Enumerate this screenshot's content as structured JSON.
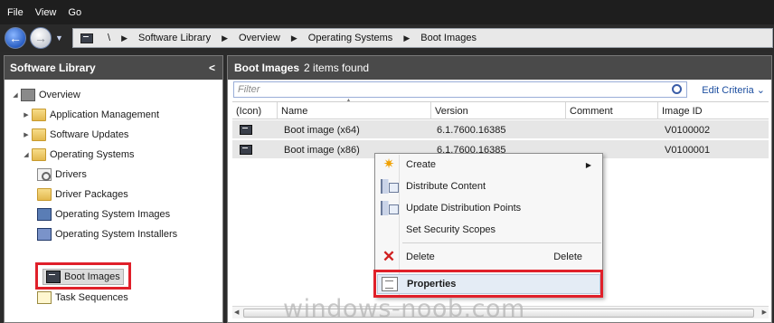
{
  "menubar": {
    "items": [
      "File",
      "View",
      "Go"
    ]
  },
  "address": {
    "crumbs": [
      "Software Library",
      "Overview",
      "Operating Systems",
      "Boot Images"
    ],
    "root_sep": "\\"
  },
  "left_panel": {
    "title": "Software Library",
    "collapse_glyph": "<",
    "tree": [
      {
        "label": "Overview",
        "icon": "overview-icon",
        "level": 0,
        "expanded": true
      },
      {
        "label": "Application Management",
        "icon": "folder-icon",
        "level": 1,
        "expanded": false
      },
      {
        "label": "Software Updates",
        "icon": "folder-icon",
        "level": 1,
        "expanded": false
      },
      {
        "label": "Operating Systems",
        "icon": "folder-icon",
        "level": 1,
        "expanded": true
      },
      {
        "label": "Drivers",
        "icon": "drivers-icon",
        "level": 2
      },
      {
        "label": "Driver Packages",
        "icon": "driver-packages-icon",
        "level": 2
      },
      {
        "label": "Operating System Images",
        "icon": "os-images-icon",
        "level": 2
      },
      {
        "label": "Operating System Installers",
        "icon": "os-installers-icon",
        "level": 2
      },
      {
        "label": "Boot Images",
        "icon": "boot-image-icon",
        "level": 2,
        "selected": true
      },
      {
        "label": "Task Sequences",
        "icon": "task-sequence-icon",
        "level": 1
      }
    ]
  },
  "right_panel": {
    "title": "Boot Images",
    "count": "2 items found",
    "filter_placeholder": "Filter",
    "edit_criteria": "Edit Criteria",
    "columns": [
      "(Icon)",
      "Name",
      "Version",
      "Comment",
      "Image ID"
    ],
    "rows": [
      {
        "name": "Boot image (x64)",
        "version": "6.1.7600.16385",
        "comment": "",
        "image_id": "V0100002"
      },
      {
        "name": "Boot image (x86)",
        "version": "6.1.7600.16385",
        "comment": "",
        "image_id": "V0100001"
      }
    ]
  },
  "context_menu": {
    "items": [
      {
        "label": "Create",
        "icon": "create-icon",
        "submenu": true
      },
      {
        "label": "Distribute Content",
        "icon": "distribute-icon"
      },
      {
        "label": "Update Distribution Points",
        "icon": "update-dp-icon"
      },
      {
        "label": "Set Security Scopes",
        "icon": ""
      },
      {
        "label": "Delete",
        "icon": "delete-icon",
        "accelerator": "Delete"
      },
      {
        "label": "Properties",
        "icon": "properties-icon",
        "highlighted": true
      }
    ]
  },
  "watermark": "windows-noob.com",
  "colors": {
    "highlight_border": "#e0202a",
    "header_bg": "#4a4a4a",
    "row_bg": "#e6e6e6"
  }
}
